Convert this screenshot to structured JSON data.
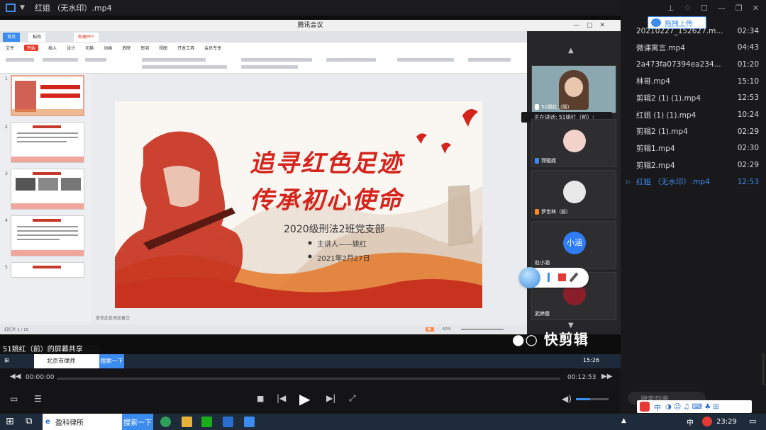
{
  "player": {
    "title": "红姐 （无水印）.mp4",
    "time_current": "00:00:00",
    "time_total": "00:12:53",
    "upload_label": "拖拽上传",
    "search_placeholder": "搜索列表"
  },
  "playlist": [
    {
      "name": "20210227_152627.m...",
      "duration": "02:34",
      "active": false
    },
    {
      "name": "微课寓言.mp4",
      "duration": "04:43",
      "active": false
    },
    {
      "name": "2a473fa07394ea234...",
      "duration": "01:20",
      "active": false
    },
    {
      "name": "林哥.mp4",
      "duration": "15:10",
      "active": false
    },
    {
      "name": "剪辑2 (1) (1).mp4",
      "duration": "12:53",
      "active": false
    },
    {
      "name": "红姐 (1) (1).mp4",
      "duration": "10:24",
      "active": false
    },
    {
      "name": "剪辑2 (1).mp4",
      "duration": "02:29",
      "active": false
    },
    {
      "name": "剪辑1.mp4",
      "duration": "02:30",
      "active": false
    },
    {
      "name": "剪辑2.mp4",
      "duration": "02:29",
      "active": false
    },
    {
      "name": "红姐 （无水印）.mp4",
      "duration": "12:53",
      "active": true
    }
  ],
  "meeting": {
    "window_title": "腾讯会议",
    "speaking": "正在讲话: 51姚红（前）;",
    "participants": [
      {
        "name": "51姚红（前）"
      },
      {
        "name": "郭甄妮"
      },
      {
        "name": "罗世林（前）"
      },
      {
        "name": "赵小涵",
        "avatar_text": "小涵"
      },
      {
        "name": "武婷霞"
      }
    ],
    "share_label": "51姚红（前）的屏幕共享",
    "watermark": "快剪辑"
  },
  "wps": {
    "tabs": [
      "首页",
      "稻壳",
      "新建PPT"
    ],
    "menu": [
      "文件",
      "开始",
      "插入",
      "设计",
      "切换",
      "动画",
      "放映",
      "审阅",
      "视图",
      "开发工具",
      "会员专享"
    ],
    "menu_active": "开始",
    "slide_count_label": "幻灯片 1 / 10",
    "zoom": "62%",
    "notes_placeholder": "单击此处添加备注"
  },
  "slide": {
    "headline_1": "追寻红色足迹",
    "headline_2": "传承初心使命",
    "org": "2020级刑法2班党支部",
    "speaker": "主讲人——姚红",
    "date": "2021年2月27日"
  },
  "inner_taskbar": {
    "app": "北京市律师",
    "search_btn": "搜索一下",
    "time": "15:26"
  },
  "taskbar": {
    "ie_label": "盈科律所",
    "search_btn": "搜索一下",
    "ime": "中",
    "time": "23:29"
  },
  "colors": {
    "accent_blue": "#3c8cf0",
    "slide_red": "#d4241b",
    "record_red": "#e53935"
  }
}
